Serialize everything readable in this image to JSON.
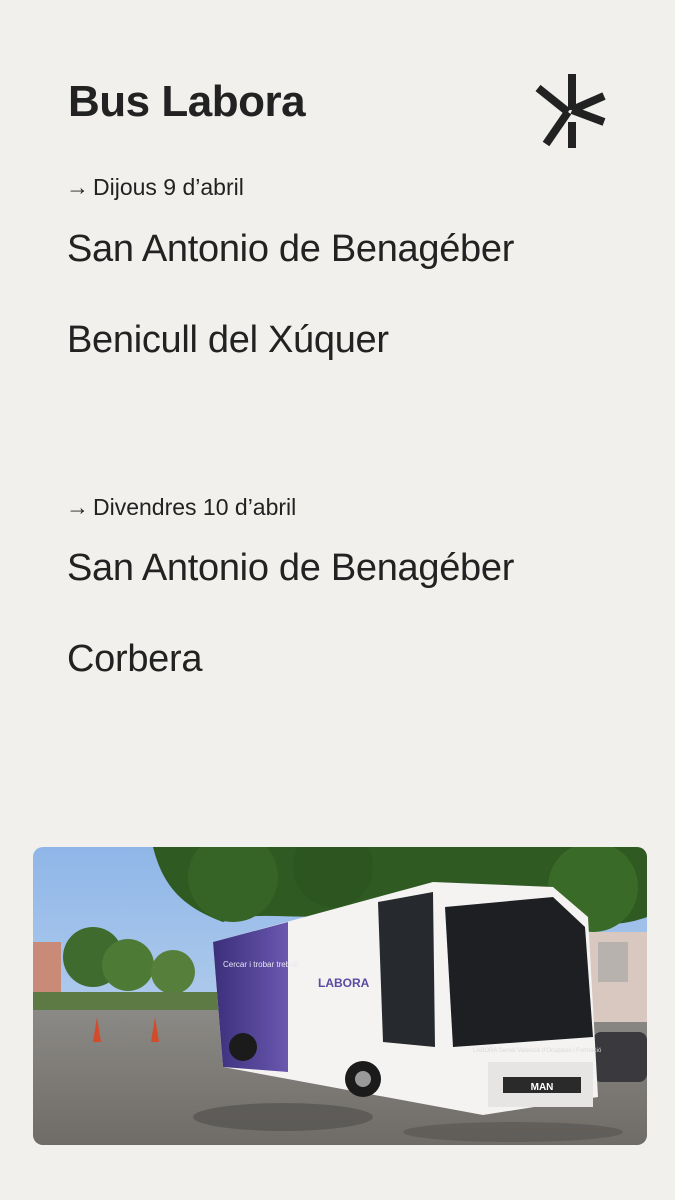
{
  "header": {
    "title": "Bus Labora",
    "logo_icon": "labora-logo-icon"
  },
  "schedule": [
    {
      "day": "Dijous 9 d’abril",
      "places": [
        "San Antonio de Benagéber",
        "Benicull del Xúquer"
      ]
    },
    {
      "day": "Divendres 10 d’abril",
      "places": [
        "San Antonio de Benagéber",
        "Corbera"
      ]
    }
  ],
  "arrow_glyph": "→",
  "photo": {
    "bus_brand": "LABORA",
    "side_text": "Cercar i trobar treball",
    "front_text": "LABORA Servei Valencià d’Ocupació i Formació",
    "maker": "MAN"
  },
  "colors": {
    "background": "#f1f0ec",
    "text": "#222222",
    "bus_purple": "#4a3a8c"
  }
}
